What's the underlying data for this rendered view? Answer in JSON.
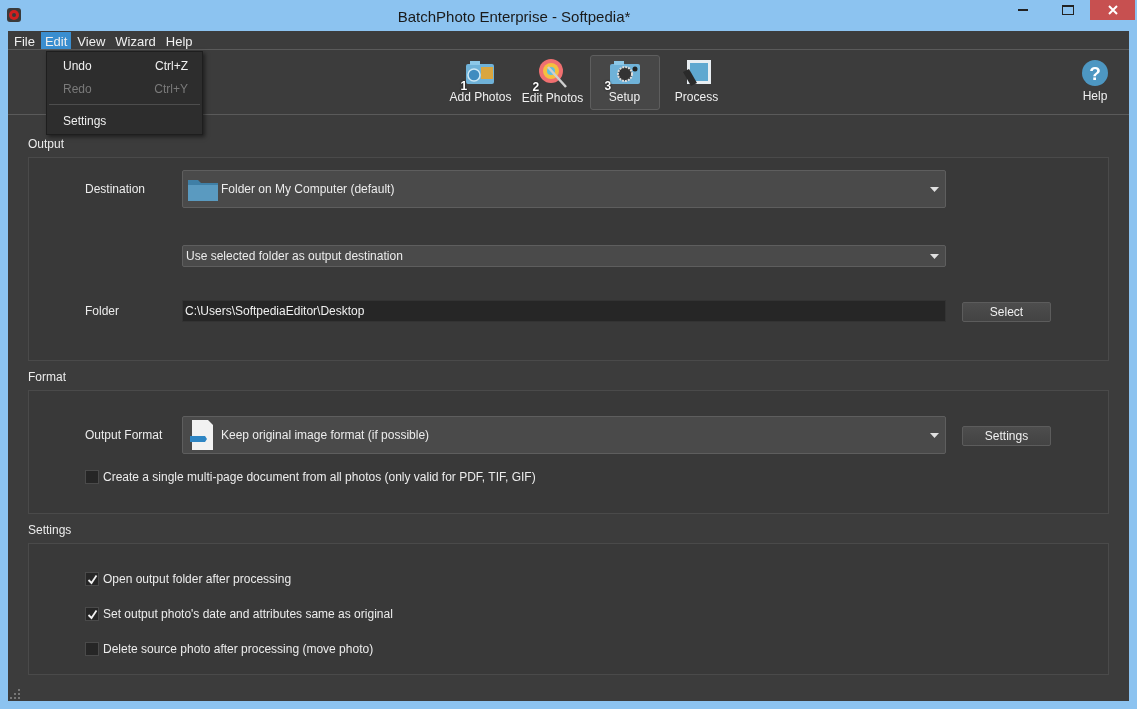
{
  "window": {
    "title": "BatchPhoto Enterprise - Softpedia*"
  },
  "menu": [
    {
      "label": "File",
      "selected": false
    },
    {
      "label": "Edit",
      "selected": true
    },
    {
      "label": "View",
      "selected": false
    },
    {
      "label": "Wizard",
      "selected": false
    },
    {
      "label": "Help",
      "selected": false
    }
  ],
  "edit_menu": [
    {
      "kind": "item",
      "label": "Undo",
      "shortcut": "Ctrl+Z",
      "disabled": false
    },
    {
      "kind": "item",
      "label": "Redo",
      "shortcut": "Ctrl+Y",
      "disabled": true
    },
    {
      "kind": "separator"
    },
    {
      "kind": "item",
      "label": "Settings",
      "disabled": false
    }
  ],
  "toolbar": [
    {
      "kind": "add",
      "step": "1",
      "label": "Add Photos",
      "selected": false
    },
    {
      "kind": "edit",
      "step": "2",
      "label": "Edit Photos",
      "selected": false
    },
    {
      "kind": "setup",
      "step": "3",
      "label": "Setup",
      "selected": true
    },
    {
      "kind": "process",
      "label": "Process",
      "selected": false
    }
  ],
  "help": {
    "glyph": "?",
    "label": "Help"
  },
  "output": {
    "title": "Output",
    "destination_label": "Destination",
    "destination": "Folder on My Computer (default)",
    "mode": "Use selected folder as output destination",
    "folder_label": "Folder",
    "folder": "C:\\Users\\SoftpediaEditor\\Desktop",
    "select_button": "Select"
  },
  "format": {
    "title": "Format",
    "output_format_label": "Output Format",
    "output_format": "Keep original image format (if possible)",
    "settings_button": "Settings",
    "multipage": {
      "label": "Create a single multi-page document from all photos (only valid for PDF, TIF, GIF)",
      "checked": false
    }
  },
  "settings": {
    "title": "Settings",
    "options": [
      {
        "label": "Open output folder after processing",
        "checked": true
      },
      {
        "label": "Set output photo's date and attributes same as original",
        "checked": true
      },
      {
        "label": "Delete source photo after processing (move photo)",
        "checked": false
      }
    ]
  }
}
